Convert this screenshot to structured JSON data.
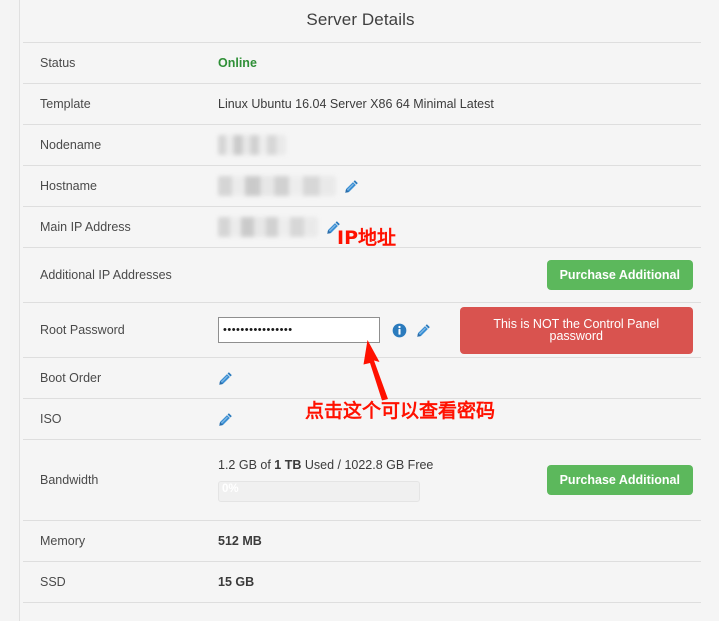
{
  "panel": {
    "title": "Server Details"
  },
  "colors": {
    "online_green": "#2f8f37",
    "button_green": "#5cb85c",
    "button_red": "#d9534f",
    "annotation_red": "#ff1100",
    "icon_blue": "#2b7bbd"
  },
  "rows": {
    "status": {
      "label": "Status",
      "value": "Online"
    },
    "template": {
      "label": "Template",
      "value": "Linux Ubuntu 16.04 Server X86 64 Minimal Latest"
    },
    "nodename": {
      "label": "Nodename",
      "value": ""
    },
    "hostname": {
      "label": "Hostname",
      "value": ""
    },
    "main_ip": {
      "label": "Main IP Address",
      "value": ""
    },
    "additional_ip": {
      "label": "Additional IP Addresses",
      "button": "Purchase Additional"
    },
    "root_password": {
      "label": "Root Password",
      "value": "••••••••••••••••",
      "placeholder": "",
      "warning_button": "This is NOT the Control Panel password"
    },
    "boot_order": {
      "label": "Boot Order",
      "value": ""
    },
    "iso": {
      "label": "ISO",
      "value": ""
    },
    "bandwidth": {
      "label": "Bandwidth",
      "usage_prefix": "1.2 GB of ",
      "usage_total": "1 TB",
      "usage_suffix": " Used / 1022.8 GB Free",
      "progress_label": "0%",
      "progress_percent": 0,
      "button": "Purchase Additional"
    },
    "memory": {
      "label": "Memory",
      "value": "512 MB"
    },
    "ssd": {
      "label": "SSD",
      "value": "15 GB"
    }
  },
  "annotations": {
    "ip_label": "IP地址",
    "click_hint": "点击这个可以查看密码"
  },
  "icons": {
    "pencil": "pencil-icon",
    "info": "info-circle-icon",
    "arrow": "arrow-up-icon"
  }
}
